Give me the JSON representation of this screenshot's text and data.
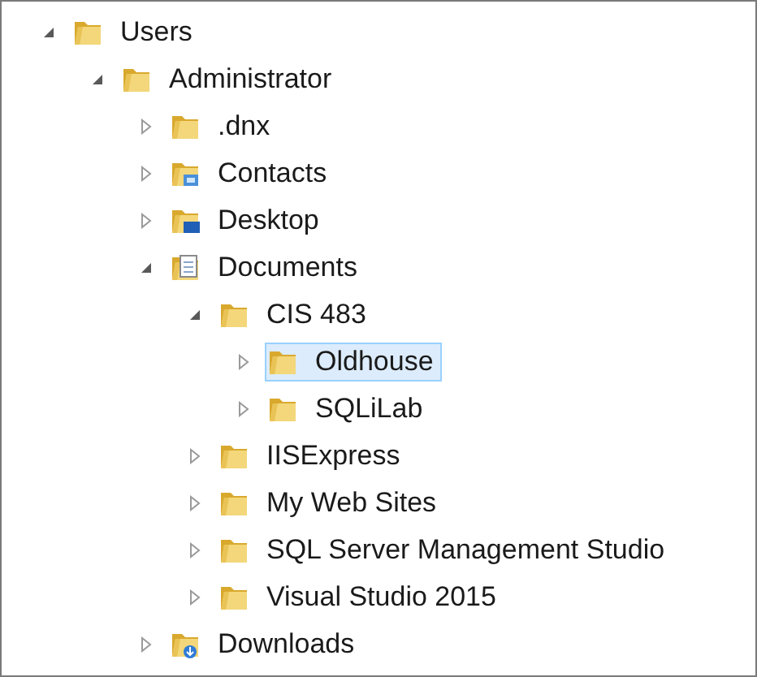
{
  "tree": [
    {
      "label": "Users",
      "kind": "folder",
      "expanded": true,
      "selected": false,
      "children": [
        {
          "label": "Administrator",
          "kind": "folder",
          "expanded": true,
          "selected": false,
          "children": [
            {
              "label": ".dnx",
              "kind": "folder",
              "expanded": false,
              "selected": false
            },
            {
              "label": "Contacts",
              "kind": "contacts",
              "expanded": false,
              "selected": false
            },
            {
              "label": "Desktop",
              "kind": "desktop",
              "expanded": false,
              "selected": false
            },
            {
              "label": "Documents",
              "kind": "documents",
              "expanded": true,
              "selected": false,
              "children": [
                {
                  "label": "CIS 483",
                  "kind": "folder",
                  "expanded": true,
                  "selected": false,
                  "children": [
                    {
                      "label": "Oldhouse",
                      "kind": "folder",
                      "expanded": false,
                      "selected": true
                    },
                    {
                      "label": "SQLiLab",
                      "kind": "folder",
                      "expanded": false,
                      "selected": false
                    }
                  ]
                },
                {
                  "label": "IISExpress",
                  "kind": "folder",
                  "expanded": false,
                  "selected": false
                },
                {
                  "label": "My Web Sites",
                  "kind": "folder",
                  "expanded": false,
                  "selected": false
                },
                {
                  "label": "SQL Server Management Studio",
                  "kind": "folder",
                  "expanded": false,
                  "selected": false
                },
                {
                  "label": "Visual Studio 2015",
                  "kind": "folder",
                  "expanded": false,
                  "selected": false
                }
              ]
            },
            {
              "label": "Downloads",
              "kind": "downloads",
              "expanded": false,
              "selected": false
            }
          ]
        }
      ]
    }
  ]
}
